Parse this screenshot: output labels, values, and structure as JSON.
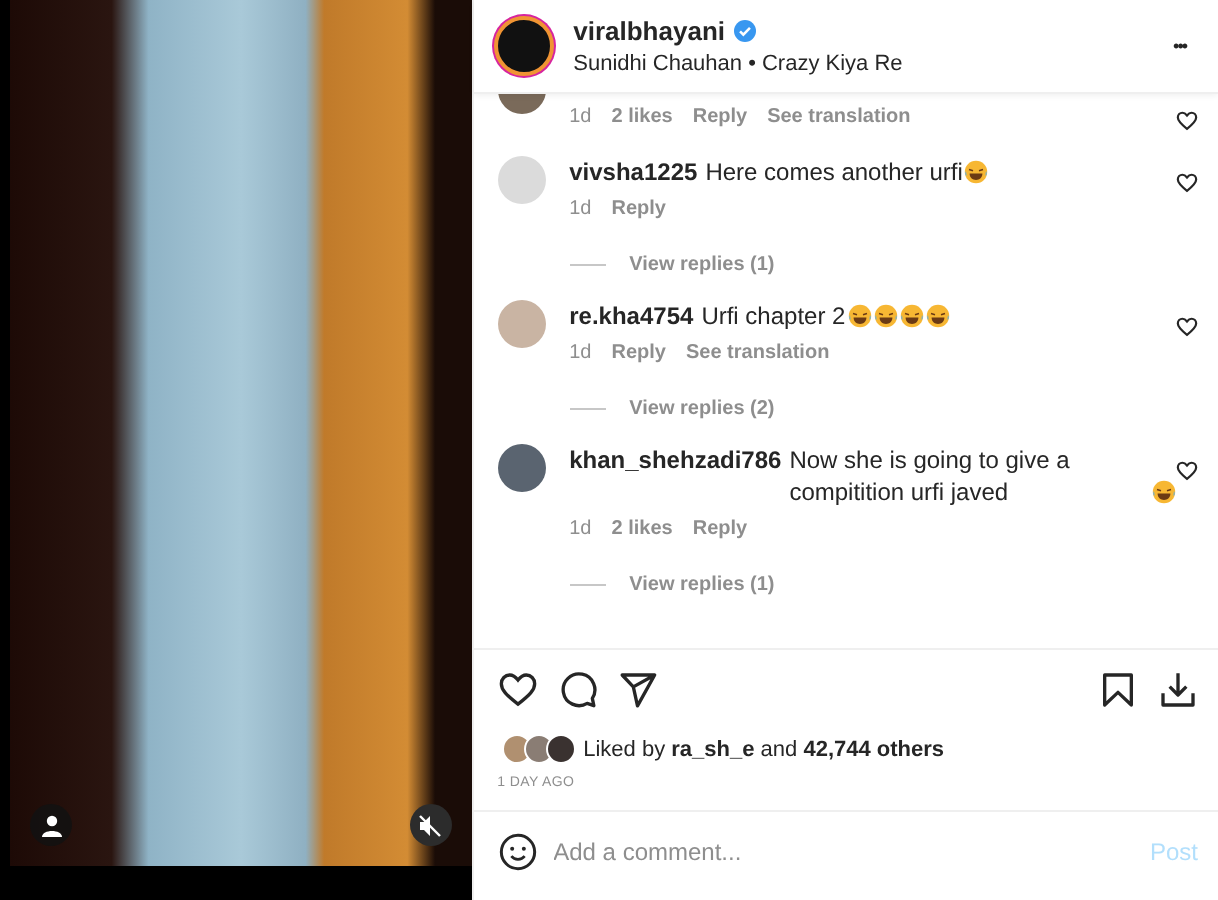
{
  "post": {
    "username": "viralbhayani",
    "verified": true,
    "audio": "Sunidhi Chauhan • Crazy Kiya Re",
    "more": "•••"
  },
  "comments": [
    {
      "age": "1d",
      "likes": "2 likes",
      "reply": "Reply",
      "translation": "See translation"
    },
    {
      "username": "vivsha1225",
      "text": "Here comes another urfi",
      "emojis": [
        {
          "kind": "laughing"
        }
      ],
      "age": "1d",
      "reply": "Reply",
      "view_replies": "View replies (1)"
    },
    {
      "username": "re.kha4754",
      "text": "Urfi chapter 2",
      "emojis": [
        {
          "kind": "laughing"
        },
        {
          "kind": "laughing"
        },
        {
          "kind": "laughing"
        },
        {
          "kind": "laughing"
        }
      ],
      "age": "1d",
      "reply": "Reply",
      "translation": "See translation",
      "view_replies": "View replies (2)"
    },
    {
      "username": "khan_shehzadi786",
      "text": "Now she is going to give a compitition urfi javed",
      "emojis": [
        {
          "kind": "laughing"
        }
      ],
      "age": "1d",
      "likes": "2 likes",
      "reply": "Reply",
      "view_replies": "View replies (1)"
    }
  ],
  "likes": {
    "text": "Liked by **ra_sh_e** and **42,744 others**"
  },
  "posted": "1 DAY AGO",
  "add_comment": {
    "placeholder": "Add a comment...",
    "post": "Post"
  }
}
